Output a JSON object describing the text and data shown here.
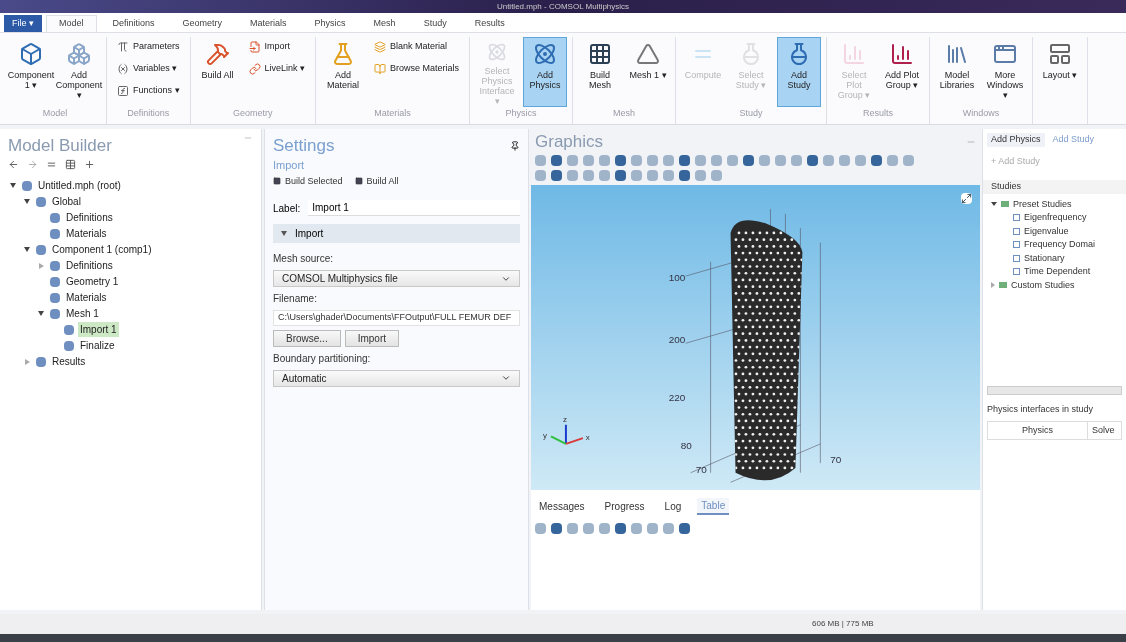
{
  "window": {
    "title": "Untitled.mph - COMSOL Multiphysics"
  },
  "file_menu": "File ▾",
  "tabs": [
    {
      "label": "Model",
      "selected": true
    },
    {
      "label": "Definitions",
      "selected": false
    },
    {
      "label": "Geometry",
      "selected": false
    },
    {
      "label": "Materials",
      "selected": false
    },
    {
      "label": "Physics",
      "selected": false
    },
    {
      "label": "Mesh",
      "selected": false
    },
    {
      "label": "Study",
      "selected": false
    },
    {
      "label": "Results",
      "selected": false
    }
  ],
  "ribbon_groups": [
    {
      "label": "Model",
      "items": [
        {
          "kind": "large",
          "label": "Component 1 ▾",
          "selected": false,
          "disabled": false
        },
        {
          "kind": "large",
          "label": "Add Component ▾",
          "selected": false,
          "disabled": false
        }
      ]
    },
    {
      "label": "Definitions",
      "items": [
        {
          "kind": "small",
          "label": "Parameters",
          "selected": false,
          "disabled": false
        },
        {
          "kind": "small",
          "label": "Variables ▾",
          "selected": false,
          "disabled": false
        },
        {
          "kind": "small",
          "label": "Functions ▾",
          "selected": false,
          "disabled": false
        }
      ]
    },
    {
      "label": "Geometry",
      "items": [
        {
          "kind": "large",
          "label": "Build All",
          "selected": false,
          "disabled": false
        },
        {
          "kind": "small",
          "label": "Import",
          "selected": false,
          "disabled": false
        },
        {
          "kind": "small",
          "label": "LiveLink ▾",
          "selected": false,
          "disabled": false
        }
      ]
    },
    {
      "label": "Materials",
      "items": [
        {
          "kind": "large",
          "label": "Add Material",
          "selected": false,
          "disabled": false
        },
        {
          "kind": "small",
          "label": "Blank Material",
          "selected": false,
          "disabled": false
        },
        {
          "kind": "small",
          "label": "Browse Materials",
          "selected": false,
          "disabled": false
        }
      ]
    },
    {
      "label": "Physics",
      "items": [
        {
          "kind": "large",
          "label": "Select Physics Interface ▾",
          "selected": false,
          "disabled": true
        },
        {
          "kind": "large",
          "label": "Add Physics",
          "selected": true,
          "disabled": false
        }
      ]
    },
    {
      "label": "Mesh",
      "items": [
        {
          "kind": "large",
          "label": "Build Mesh",
          "selected": false,
          "disabled": false
        },
        {
          "kind": "large",
          "label": "Mesh 1 ▾",
          "selected": false,
          "disabled": false
        }
      ]
    },
    {
      "label": "Study",
      "items": [
        {
          "kind": "large",
          "label": "Compute",
          "selected": false,
          "disabled": true
        },
        {
          "kind": "large",
          "label": "Select Study ▾",
          "selected": false,
          "disabled": true
        },
        {
          "kind": "large",
          "label": "Add Study",
          "selected": true,
          "disabled": false
        }
      ]
    },
    {
      "label": "Results",
      "items": [
        {
          "kind": "large",
          "label": "Select Plot Group ▾",
          "selected": false,
          "disabled": true
        },
        {
          "kind": "large",
          "label": "Add Plot Group ▾",
          "selected": false,
          "disabled": false
        }
      ]
    },
    {
      "label": "Windows",
      "items": [
        {
          "kind": "large",
          "label": "Model Libraries",
          "selected": false,
          "disabled": false
        },
        {
          "kind": "large",
          "label": "More Windows ▾",
          "selected": false,
          "disabled": false
        }
      ]
    },
    {
      "items": [
        {
          "kind": "large",
          "label": "Layout ▾",
          "selected": false,
          "disabled": false
        }
      ]
    }
  ],
  "model_builder": {
    "title": "Model Builder",
    "tree": [
      {
        "label": "Untitled.mph (root)",
        "expanded": true,
        "selected": false,
        "children": [
          {
            "label": "Global",
            "expanded": true,
            "selected": false,
            "children": [
              {
                "label": "Definitions",
                "selected": false
              },
              {
                "label": "Materials",
                "selected": false
              }
            ]
          },
          {
            "label": "Component 1 (comp1)",
            "expanded": true,
            "selected": false,
            "children": [
              {
                "label": "Definitions",
                "expanded": false,
                "selected": false
              },
              {
                "label": "Geometry 1",
                "selected": false
              },
              {
                "label": "Materials",
                "selected": false
              },
              {
                "label": "Mesh 1",
                "expanded": true,
                "selected": false,
                "children": [
                  {
                    "label": "Import 1",
                    "selected": true
                  },
                  {
                    "label": "Finalize",
                    "selected": false
                  }
                ]
              }
            ]
          },
          {
            "label": "Results",
            "expanded": false,
            "selected": false
          }
        ]
      }
    ]
  },
  "settings": {
    "title": "Settings",
    "subtitle": "Import",
    "actions": [
      "Build Selected",
      "Build All"
    ],
    "label_caption": "Label:",
    "label_value": "Import 1",
    "section": {
      "title": "Import",
      "expanded": true
    },
    "mesh_source": {
      "caption": "Mesh source:",
      "value": "COMSOL Multiphysics file"
    },
    "filename": {
      "caption": "Filename:",
      "value": "C:\\Users\\ghader\\Documents\\FFOutput\\FULL FEMUR DEF"
    },
    "buttons": [
      "Browse...",
      "Import"
    ],
    "boundary": {
      "caption": "Boundary partitioning:",
      "value": "Automatic"
    }
  },
  "graphics": {
    "title": "Graphics",
    "axis_ticks": [
      "100",
      "200",
      "220",
      "80",
      "70",
      "70"
    ],
    "triad": [
      "z",
      "y",
      "x"
    ]
  },
  "side_panel": {
    "tabs": [
      {
        "label": "Add Physics",
        "selected": true
      },
      {
        "label": "Add Study",
        "selected": false
      }
    ],
    "add_button": "+ Add Study",
    "studies_header": "Studies",
    "tree": [
      {
        "label": "Preset Studies",
        "expanded": true,
        "children": [
          {
            "label": "Eigenfrequency"
          },
          {
            "label": "Eigenvalue"
          },
          {
            "label": "Frequency Domai"
          },
          {
            "label": "Stationary"
          },
          {
            "label": "Time Dependent"
          }
        ]
      },
      {
        "label": "Custom Studies",
        "expanded": false
      }
    ],
    "interfaces_label": "Physics interfaces in study",
    "columns": [
      "Physics",
      "Solve"
    ]
  },
  "messages": {
    "tabs": [
      {
        "label": "Messages",
        "selected": false
      },
      {
        "label": "Progress",
        "selected": false
      },
      {
        "label": "Log",
        "selected": false
      },
      {
        "label": "Table",
        "selected": true
      }
    ]
  },
  "status_bar": "606 MB | 775 MB"
}
